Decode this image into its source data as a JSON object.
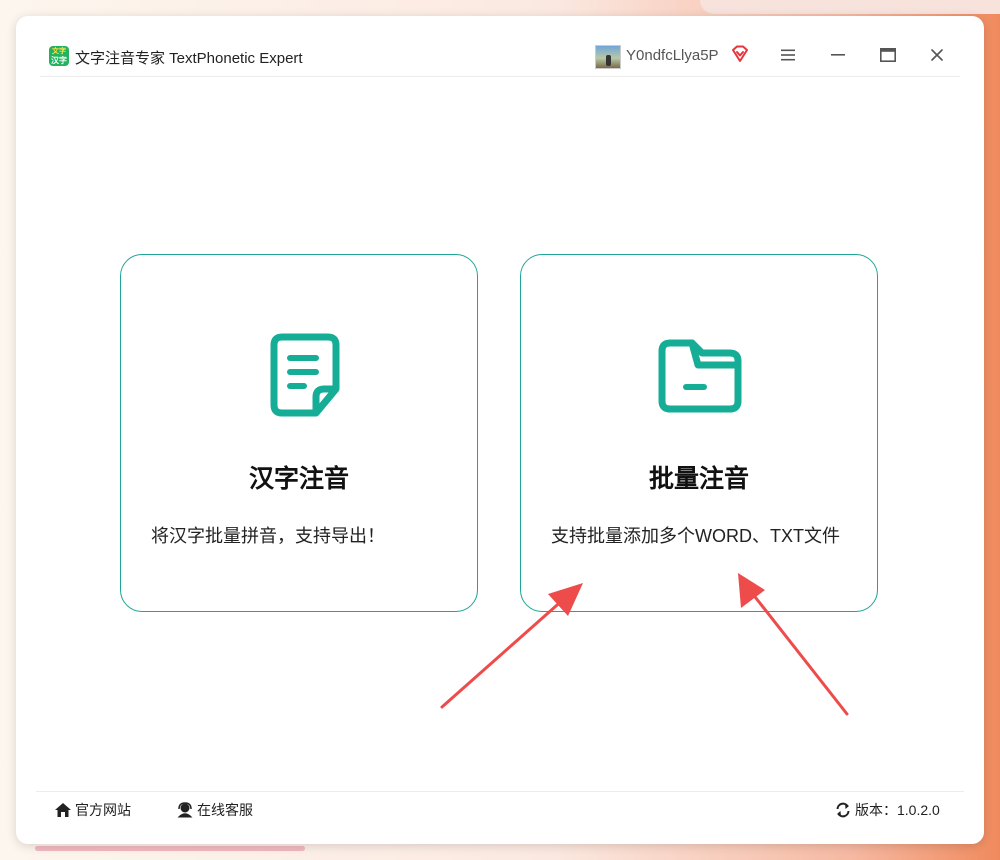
{
  "window": {
    "title": "文字注音专家 TextPhonetic Expert",
    "logo_text_top": "文字",
    "logo_text_bottom": "汉字"
  },
  "user": {
    "name": "Y0ndfcLlya5P",
    "vip_icon": "vip-diamond-icon"
  },
  "controls": {
    "menu": "menu-icon",
    "minimize": "minimize-icon",
    "maximize": "maximize-icon",
    "close": "close-icon"
  },
  "cards": [
    {
      "icon": "document-icon",
      "title": "汉字注音",
      "description": "将汉字批量拼音，支持导出！"
    },
    {
      "icon": "folder-icon",
      "title": "批量注音",
      "description": "支持批量添加多个WORD、TXT文件"
    }
  ],
  "footer": {
    "official_site": "官方网站",
    "online_service": "在线客服",
    "version_label": "版本：",
    "version": "1.0.2.0"
  },
  "colors": {
    "accent": "#16ad97",
    "card_border": "#1fa596",
    "arrow": "#ee4b4b",
    "vip": "#e8343c"
  }
}
